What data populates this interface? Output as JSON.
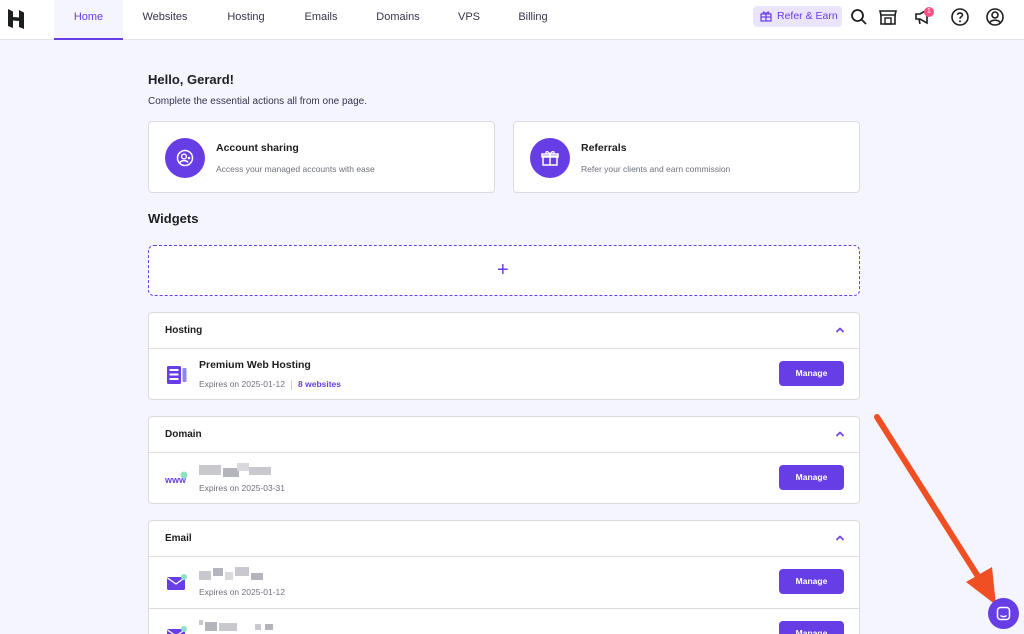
{
  "nav": {
    "tabs": [
      {
        "label": "Home",
        "active": true
      },
      {
        "label": "Websites"
      },
      {
        "label": "Hosting"
      },
      {
        "label": "Emails"
      },
      {
        "label": "Domains"
      },
      {
        "label": "VPS"
      },
      {
        "label": "Billing"
      }
    ],
    "refer_label": "Refer & Earn",
    "notification_count": "1",
    "icons": [
      "gift-icon",
      "search-icon",
      "store-icon",
      "megaphone-icon",
      "help-icon",
      "account-icon"
    ]
  },
  "greeting": "Hello, Gerard!",
  "subtitle": "Complete the essential actions all from one page.",
  "actions": [
    {
      "title": "Account sharing",
      "description": "Access your managed accounts with ease",
      "icon": "account-sharing-icon"
    },
    {
      "title": "Referrals",
      "description": "Refer your clients and earn commission",
      "icon": "gift-icon"
    }
  ],
  "widgets": {
    "title": "Widgets",
    "add_symbol": "+",
    "hosting": {
      "title": "Hosting",
      "items": [
        {
          "name": "Premium Web Hosting",
          "expires": "Expires on 2025-01-12",
          "websites": "8 websites",
          "button": "Manage"
        }
      ]
    },
    "domain": {
      "title": "Domain",
      "items": [
        {
          "expires": "Expires on 2025-03-31",
          "button": "Manage"
        }
      ]
    },
    "email": {
      "title": "Email",
      "items": [
        {
          "expires": "Expires on 2025-01-12",
          "button": "Manage"
        },
        {
          "button": "Manage"
        }
      ]
    }
  },
  "colors": {
    "brand": "#673de6",
    "arrow": "#f04e23",
    "badge": "#fc5185"
  }
}
